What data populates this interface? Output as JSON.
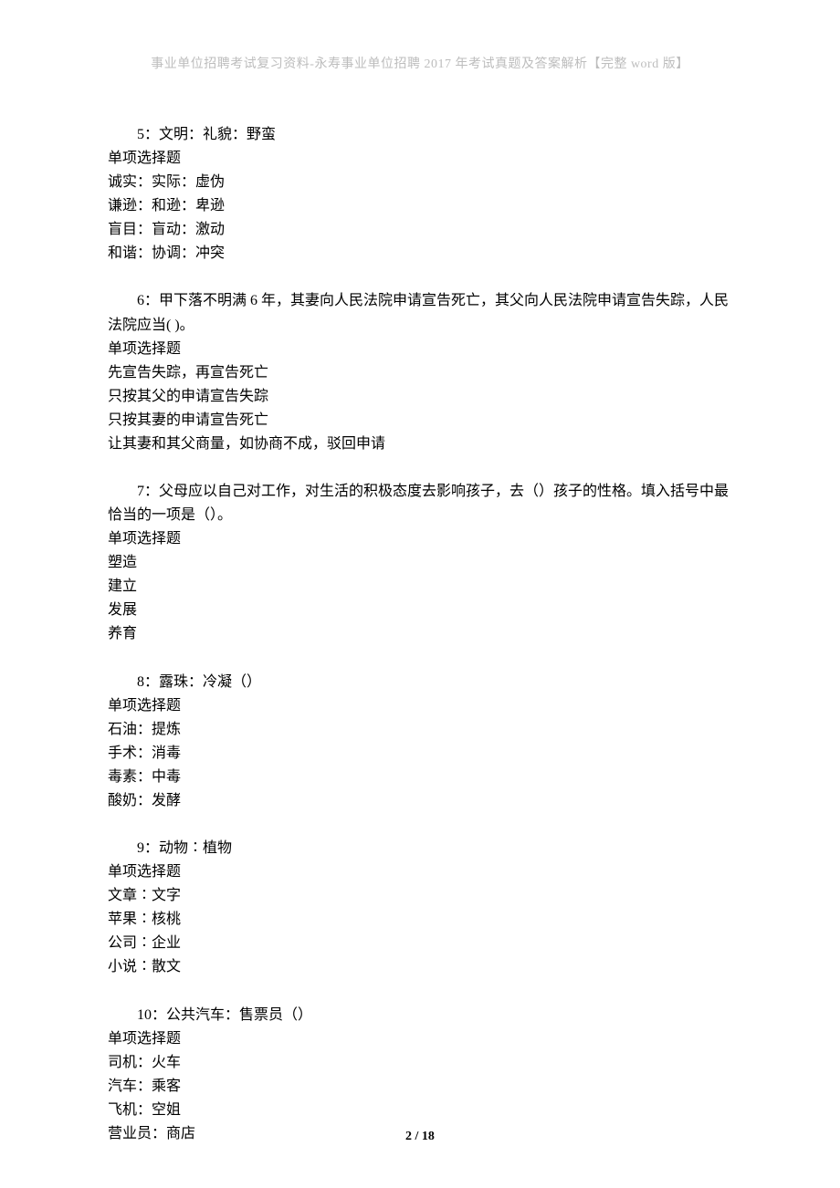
{
  "header": "事业单位招聘考试复习资料-永寿事业单位招聘 2017 年考试真题及答案解析【完整 word 版】",
  "footer": "2 / 18",
  "questions": [
    {
      "stem": "5：文明：礼貌：野蛮",
      "type": "单项选择题",
      "options": [
        "诚实：实际：虚伪",
        "谦逊：和逊：卑逊",
        "盲目：盲动：激动",
        "和谐：协调：冲突"
      ]
    },
    {
      "stem": "6：甲下落不明满 6 年，其妻向人民法院申请宣告死亡，其父向人民法院申请宣告失踪，人民法院应当( )。",
      "type": "单项选择题",
      "options": [
        "先宣告失踪，再宣告死亡",
        "只按其父的申请宣告失踪",
        "只按其妻的申请宣告死亡",
        "让其妻和其父商量，如协商不成，驳回申请"
      ]
    },
    {
      "stem": "7：父母应以自己对工作，对生活的积极态度去影响孩子，去（）孩子的性格。填入括号中最恰当的一项是（）。",
      "type": "单项选择题",
      "options": [
        "塑造",
        "建立",
        "发展",
        "养育"
      ]
    },
    {
      "stem": "8：露珠：冷凝（）",
      "type": "单项选择题",
      "options": [
        "石油：提炼",
        "手术：消毒",
        "毒素：中毒",
        "酸奶：发酵"
      ]
    },
    {
      "stem": "9：动物∶植物",
      "type": "单项选择题",
      "options": [
        "文章∶文字",
        "苹果∶核桃",
        "公司∶企业",
        "小说∶散文"
      ]
    },
    {
      "stem": "10：公共汽车：售票员（）",
      "type": "单项选择题",
      "options": [
        "司机：火车",
        "汽车：乘客",
        "飞机：空姐",
        "营业员：商店"
      ]
    }
  ]
}
